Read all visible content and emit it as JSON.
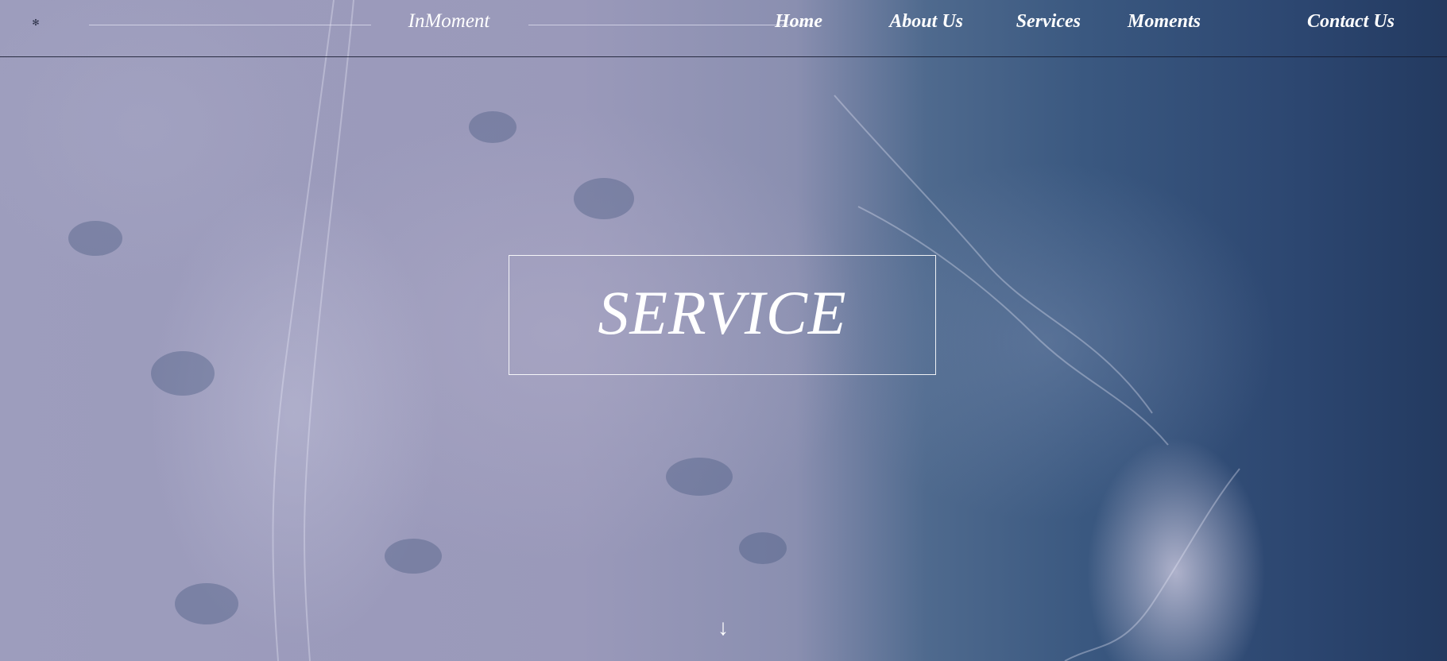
{
  "header": {
    "brand_name": "InMoment",
    "nav": [
      {
        "label": "Home"
      },
      {
        "label": "About Us"
      },
      {
        "label": "Services"
      },
      {
        "label": "Moments"
      },
      {
        "label": "Contact Us"
      }
    ]
  },
  "hero": {
    "title": "SERVICE",
    "scroll_arrow": "↓",
    "background": "ocean-waves-aerial"
  },
  "colors": {
    "text": "#ffffff",
    "header_border": "#141a2d",
    "foam": "#9d9dbd",
    "deep_water": "#233a60"
  }
}
